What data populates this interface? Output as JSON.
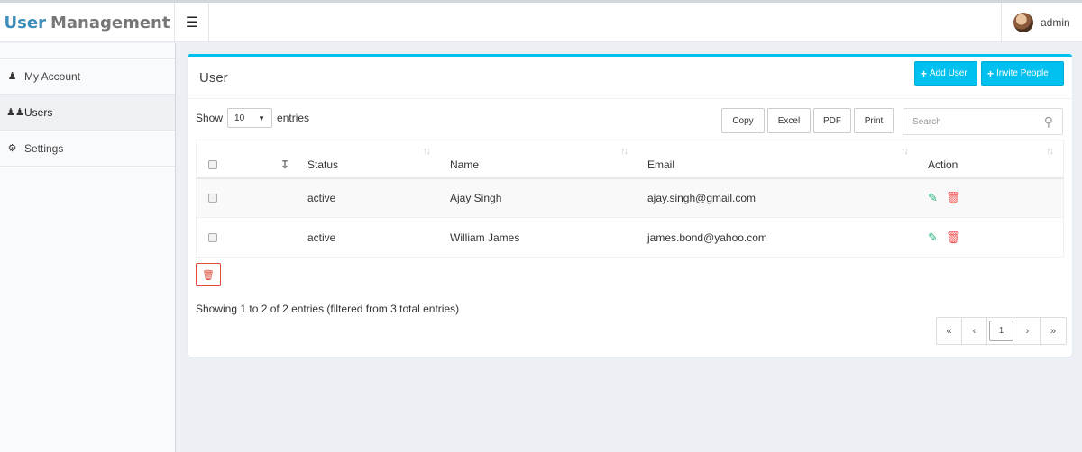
{
  "app": {
    "logo_bold": "User",
    "logo_light": "Management",
    "menu_icon": "hamburger-icon",
    "user_name": "admin"
  },
  "sidebar": {
    "items": [
      {
        "label": "My Account",
        "icon": "user-icon"
      },
      {
        "label": "Users",
        "icon": "users-icon"
      },
      {
        "label": "Settings",
        "icon": "gears-icon"
      }
    ]
  },
  "box": {
    "title": "User",
    "add_user_label": "Add User",
    "invite_label": "Invite People"
  },
  "controls": {
    "show_label": "Show",
    "entries_value": "10",
    "entries_label": "entries",
    "copy_label": "Copy",
    "excel_label": "Excel",
    "pdf_label": "PDF",
    "print_label": "Print",
    "search_placeholder": "Search"
  },
  "table": {
    "columns": [
      "Status",
      "Name",
      "Email",
      "Action"
    ],
    "rows": [
      {
        "status": "active",
        "name": "Ajay Singh",
        "email": "ajay.singh@gmail.com"
      },
      {
        "status": "active",
        "name": "William James",
        "email": "james.bond@yahoo.com"
      }
    ]
  },
  "footer": {
    "info": "Showing 1 to 2 of 2 entries (filtered from 3 total entries)",
    "pagination": {
      "first": "«",
      "prev": "‹",
      "current": "1",
      "next": "›",
      "last": "»"
    }
  },
  "colors": {
    "accent": "#00c0ef",
    "brand": "#3c8dbc",
    "edit": "#2ab27b",
    "danger": "#dd4b39"
  }
}
